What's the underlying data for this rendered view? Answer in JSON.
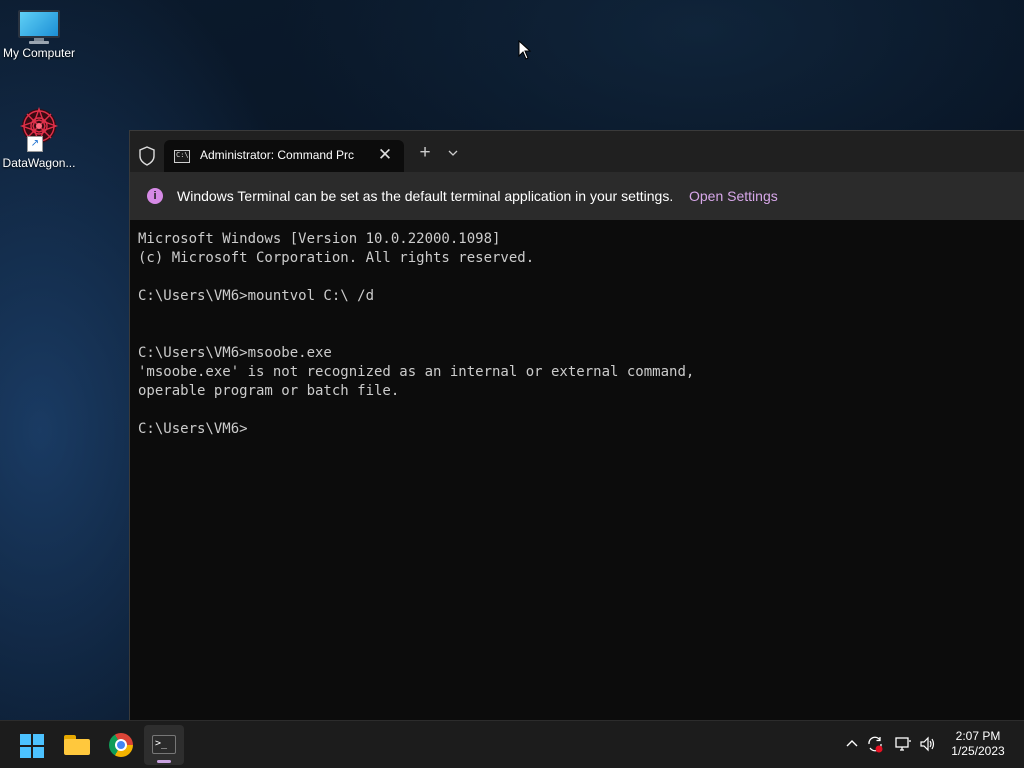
{
  "desktop": {
    "icons": [
      {
        "label": "My Computer",
        "icon": "monitor-icon"
      },
      {
        "label": "DataWagon...",
        "icon": "datawagon-icon"
      }
    ]
  },
  "terminal": {
    "tab_title": "Administrator:  Command Prc",
    "tab_icon": "cmd-icon",
    "close_glyph": "✕",
    "new_tab_glyph": "+",
    "infobar": {
      "message": "Windows Terminal can be set as the default terminal application in your settings.",
      "link": "Open Settings",
      "icon_glyph": "i"
    },
    "console_lines": [
      "Microsoft Windows [Version 10.0.22000.1098]",
      "(c) Microsoft Corporation. All rights reserved.",
      "",
      "C:\\Users\\VM6>mountvol C:\\ /d",
      "",
      "",
      "C:\\Users\\VM6>msoobe.exe",
      "'msoobe.exe' is not recognized as an internal or external command,",
      "operable program or batch file.",
      "",
      "C:\\Users\\VM6>"
    ]
  },
  "taskbar": {
    "apps": [
      "start-button",
      "file-explorer",
      "chrome",
      "terminal"
    ],
    "tray": {
      "chevron_glyph": "^",
      "volume_glyph": "🔊"
    },
    "clock": {
      "time": "2:07 PM",
      "date": "1/25/2023"
    }
  },
  "colors": {
    "accent": "#4cc2ff",
    "link": "#d7a7e9",
    "info_icon": "#d68ae6"
  }
}
